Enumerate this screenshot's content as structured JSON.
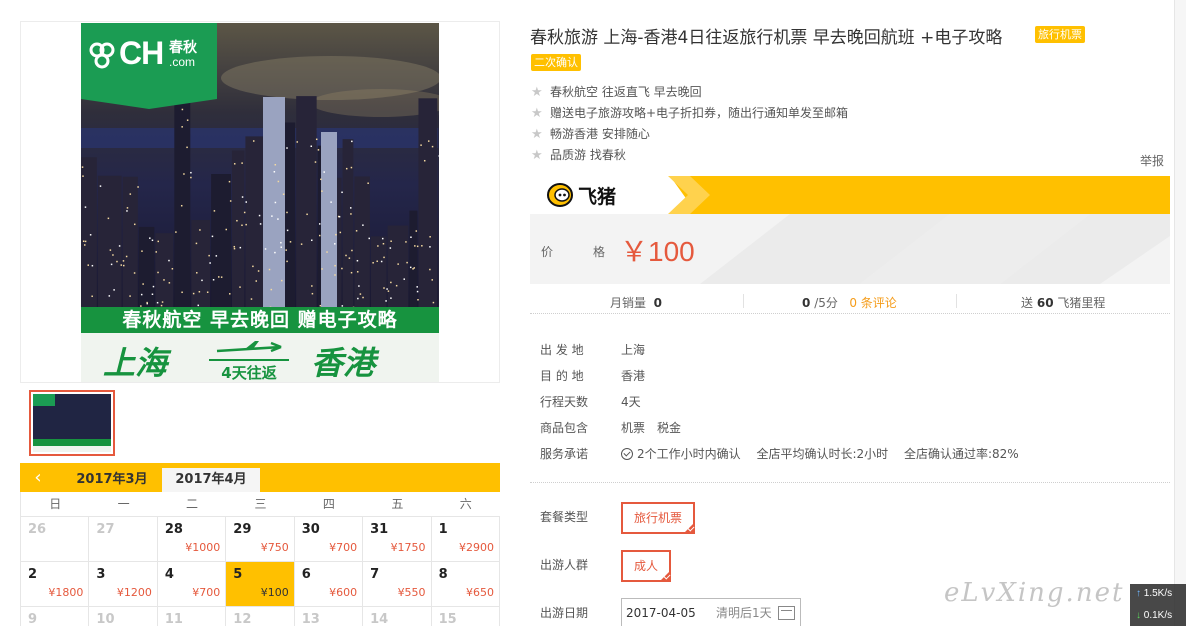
{
  "product": {
    "title": "春秋旅游 上海-香港4日往返旅行机票 早去晚回航班 +电子攻略",
    "tags": [
      "旅行机票",
      "二次确认"
    ],
    "features": [
      "春秋航空 往返直飞 早去晚回",
      "赠送电子旅游攻略+电子折扣券，随出行通知单发至邮箱",
      "畅游香港 安排随心",
      "品质游 找春秋"
    ],
    "report_label": "举报"
  },
  "poster": {
    "logo_brand": "CH",
    "logo_cn": "春秋",
    "logo_com": ".com",
    "banner": "春秋航空 早去晚回 赠电子攻略",
    "route_from": "上海",
    "route_days": "4天往返",
    "route_to": "香港"
  },
  "price_box": {
    "platform": "飞猪",
    "price_label": "价　格",
    "price_value": "￥100"
  },
  "stats": {
    "monthly_sales_label": "月销量",
    "monthly_sales": "0",
    "rating": "0",
    "rating_suffix": "/5分",
    "reviews_label": "0 条评论",
    "miles_prefix": "送",
    "miles": "60",
    "miles_suffix": "飞猪里程"
  },
  "properties": [
    {
      "key": "出 发 地",
      "value": "上海"
    },
    {
      "key": "目 的 地",
      "value": "香港"
    },
    {
      "key": "行程天数",
      "value": "4天"
    },
    {
      "key": "商品包含",
      "value": "机票　税金"
    },
    {
      "key": "服务承诺",
      "value": "2个工作小时内确认　 全店平均确认时长:2小时　 全店确认通过率:82%"
    }
  ],
  "options": {
    "package_label": "套餐类型",
    "package_value": "旅行机票",
    "crowd_label": "出游人群",
    "crowd_value": "成人",
    "date_label": "出游日期",
    "date_value": "2017-04-05",
    "date_hint": "清明后1天"
  },
  "calendar": {
    "prev_icon": "chevron-left-icon",
    "months": [
      "2017年3月",
      "2017年4月"
    ],
    "active_month": 1,
    "weekdays": [
      "日",
      "一",
      "二",
      "三",
      "四",
      "五",
      "六"
    ],
    "cells": [
      {
        "day": "26",
        "price": "",
        "dim": true
      },
      {
        "day": "27",
        "price": "",
        "dim": true
      },
      {
        "day": "28",
        "price": "¥1000",
        "dim": false
      },
      {
        "day": "29",
        "price": "¥750",
        "dim": false
      },
      {
        "day": "30",
        "price": "¥700",
        "dim": false
      },
      {
        "day": "31",
        "price": "¥1750",
        "dim": false
      },
      {
        "day": "1",
        "price": "¥2900",
        "dim": false
      },
      {
        "day": "2",
        "price": "¥1800",
        "dim": false
      },
      {
        "day": "3",
        "price": "¥1200",
        "dim": false
      },
      {
        "day": "4",
        "price": "¥700",
        "dim": false
      },
      {
        "day": "5",
        "price": "¥100",
        "dim": false,
        "selected": true
      },
      {
        "day": "6",
        "price": "¥600",
        "dim": false
      },
      {
        "day": "7",
        "price": "¥550",
        "dim": false
      },
      {
        "day": "8",
        "price": "¥650",
        "dim": false
      },
      {
        "day": "9",
        "price": "",
        "dim": true
      },
      {
        "day": "10",
        "price": "",
        "dim": true
      },
      {
        "day": "11",
        "price": "",
        "dim": true
      },
      {
        "day": "12",
        "price": "",
        "dim": true
      },
      {
        "day": "13",
        "price": "",
        "dim": true
      },
      {
        "day": "14",
        "price": "",
        "dim": true
      },
      {
        "day": "15",
        "price": "",
        "dim": true
      }
    ]
  },
  "watermark": "eLvXing.net",
  "net_widget": {
    "up": "1.5K/s",
    "down": "0.1K/s"
  },
  "colors": {
    "accent": "#ffc000",
    "price": "#e5593d",
    "brand_green": "#17933f",
    "link": "#f59c1a"
  }
}
